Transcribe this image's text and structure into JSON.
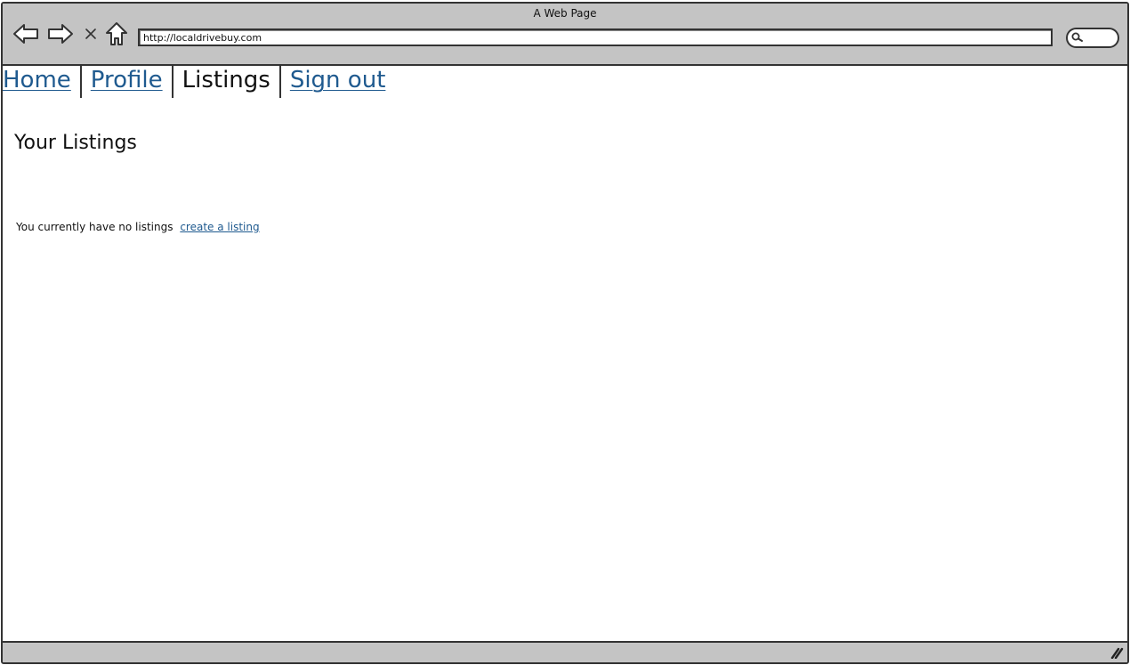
{
  "window": {
    "title": "A Web Page"
  },
  "toolbar": {
    "back_icon": "arrow-left-icon",
    "forward_icon": "arrow-right-icon",
    "stop_icon": "close-icon",
    "home_icon": "home-icon",
    "url": "http://localdrivebuy.com",
    "search_icon": "search-icon"
  },
  "nav": {
    "tabs": [
      {
        "label": "Home",
        "active": false
      },
      {
        "label": "Profile",
        "active": false
      },
      {
        "label": "Listings",
        "active": true
      },
      {
        "label": "Sign out",
        "active": false
      }
    ]
  },
  "main": {
    "title": "Your Listings",
    "empty_message": "You currently have no listings",
    "create_link": "create a listing"
  },
  "statusbar": {
    "grip_icon": "resize-grip-icon"
  },
  "colors": {
    "link": "#1f5a8f",
    "chrome": "#c4c4c4",
    "border": "#333333"
  }
}
